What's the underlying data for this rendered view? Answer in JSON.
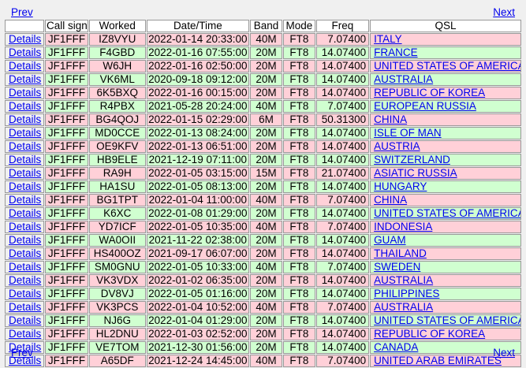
{
  "nav": {
    "prev_label": "Prev",
    "next_label": "Next"
  },
  "table": {
    "headers": [
      "",
      "Call sign",
      "Worked",
      "Date/Time",
      "Band",
      "Mode",
      "Freq",
      "QSL"
    ],
    "rows": [
      {
        "link": "Details",
        "call": "JF1FFF",
        "worked": "IZ8VYU",
        "dt": "2022-01-14 20:33:00",
        "band": "40M",
        "mode": "FT8",
        "freq": "7.07400",
        "qsl": "ITALY"
      },
      {
        "link": "Details",
        "call": "JF1FFF",
        "worked": "F4GBD",
        "dt": "2022-01-16 07:55:00",
        "band": "20M",
        "mode": "FT8",
        "freq": "14.07400",
        "qsl": "FRANCE"
      },
      {
        "link": "Details",
        "call": "JF1FFF",
        "worked": "W6JH",
        "dt": "2022-01-16 02:50:00",
        "band": "20M",
        "mode": "FT8",
        "freq": "14.07400",
        "qsl": "UNITED STATES OF AMERICA"
      },
      {
        "link": "Details",
        "call": "JF1FFF",
        "worked": "VK6ML",
        "dt": "2020-09-18 09:12:00",
        "band": "20M",
        "mode": "FT8",
        "freq": "14.07400",
        "qsl": "AUSTRALIA"
      },
      {
        "link": "Details",
        "call": "JF1FFF",
        "worked": "6K5BXQ",
        "dt": "2022-01-16 00:15:00",
        "band": "20M",
        "mode": "FT8",
        "freq": "14.07400",
        "qsl": "REPUBLIC OF KOREA"
      },
      {
        "link": "Details",
        "call": "JF1FFF",
        "worked": "R4PBX",
        "dt": "2021-05-28 20:24:00",
        "band": "40M",
        "mode": "FT8",
        "freq": "7.07400",
        "qsl": "EUROPEAN RUSSIA"
      },
      {
        "link": "Details",
        "call": "JF1FFF",
        "worked": "BG4QOJ",
        "dt": "2022-01-15 02:29:00",
        "band": "6M",
        "mode": "FT8",
        "freq": "50.31300",
        "qsl": "CHINA"
      },
      {
        "link": "Details",
        "call": "JF1FFF",
        "worked": "MD0CCE",
        "dt": "2022-01-13 08:24:00",
        "band": "20M",
        "mode": "FT8",
        "freq": "14.07400",
        "qsl": "ISLE OF MAN"
      },
      {
        "link": "Details",
        "call": "JF1FFF",
        "worked": "OE9KFV",
        "dt": "2022-01-13 06:51:00",
        "band": "20M",
        "mode": "FT8",
        "freq": "14.07400",
        "qsl": "AUSTRIA"
      },
      {
        "link": "Details",
        "call": "JF1FFF",
        "worked": "HB9ELE",
        "dt": "2021-12-19 07:11:00",
        "band": "20M",
        "mode": "FT8",
        "freq": "14.07400",
        "qsl": "SWITZERLAND"
      },
      {
        "link": "Details",
        "call": "JF1FFF",
        "worked": "RA9H",
        "dt": "2022-01-05 03:15:00",
        "band": "15M",
        "mode": "FT8",
        "freq": "21.07400",
        "qsl": "ASIATIC RUSSIA"
      },
      {
        "link": "Details",
        "call": "JF1FFF",
        "worked": "HA1SU",
        "dt": "2022-01-05 08:13:00",
        "band": "20M",
        "mode": "FT8",
        "freq": "14.07400",
        "qsl": "HUNGARY"
      },
      {
        "link": "Details",
        "call": "JF1FFF",
        "worked": "BG1TPT",
        "dt": "2022-01-04 11:00:00",
        "band": "40M",
        "mode": "FT8",
        "freq": "7.07400",
        "qsl": "CHINA"
      },
      {
        "link": "Details",
        "call": "JF1FFF",
        "worked": "K6XC",
        "dt": "2022-01-08 01:29:00",
        "band": "20M",
        "mode": "FT8",
        "freq": "14.07400",
        "qsl": "UNITED STATES OF AMERICA"
      },
      {
        "link": "Details",
        "call": "JF1FFF",
        "worked": "YD7ICF",
        "dt": "2022-01-05 10:35:00",
        "band": "40M",
        "mode": "FT8",
        "freq": "7.07400",
        "qsl": "INDONESIA"
      },
      {
        "link": "Details",
        "call": "JF1FFF",
        "worked": "WA0OII",
        "dt": "2021-11-22 02:38:00",
        "band": "20M",
        "mode": "FT8",
        "freq": "14.07400",
        "qsl": "GUAM"
      },
      {
        "link": "Details",
        "call": "JF1FFF",
        "worked": "HS400OZ",
        "dt": "2021-09-17 06:07:00",
        "band": "20M",
        "mode": "FT8",
        "freq": "14.07400",
        "qsl": "THAILAND"
      },
      {
        "link": "Details",
        "call": "JF1FFF",
        "worked": "SM0GNU",
        "dt": "2022-01-05 10:33:00",
        "band": "40M",
        "mode": "FT8",
        "freq": "7.07400",
        "qsl": "SWEDEN"
      },
      {
        "link": "Details",
        "call": "JF1FFF",
        "worked": "VK3VDX",
        "dt": "2022-01-02 06:35:00",
        "band": "20M",
        "mode": "FT8",
        "freq": "14.07400",
        "qsl": "AUSTRALIA"
      },
      {
        "link": "Details",
        "call": "JF1FFF",
        "worked": "DV8VJ",
        "dt": "2022-01-05 01:16:00",
        "band": "20M",
        "mode": "FT8",
        "freq": "14.07400",
        "qsl": "PHILIPPINES"
      },
      {
        "link": "Details",
        "call": "JF1FFF",
        "worked": "VK3PCS",
        "dt": "2022-01-04 10:52:00",
        "band": "40M",
        "mode": "FT8",
        "freq": "7.07400",
        "qsl": "AUSTRALIA"
      },
      {
        "link": "Details",
        "call": "JF1FFF",
        "worked": "NJ6G",
        "dt": "2022-01-04 01:29:00",
        "band": "20M",
        "mode": "FT8",
        "freq": "14.07400",
        "qsl": "UNITED STATES OF AMERICA"
      },
      {
        "link": "Details",
        "call": "JF1FFF",
        "worked": "HL2DNU",
        "dt": "2022-01-03 02:52:00",
        "band": "20M",
        "mode": "FT8",
        "freq": "14.07400",
        "qsl": "REPUBLIC OF KOREA"
      },
      {
        "link": "Details",
        "call": "JF1FFF",
        "worked": "VE7TOM",
        "dt": "2021-12-30 01:56:00",
        "band": "20M",
        "mode": "FT8",
        "freq": "14.07400",
        "qsl": "CANADA"
      },
      {
        "link": "Details",
        "call": "JF1FFF",
        "worked": "A65DF",
        "dt": "2021-12-24 14:45:00",
        "band": "40M",
        "mode": "FT8",
        "freq": "7.07400",
        "qsl": "UNITED ARAB EMIRATES"
      }
    ]
  },
  "colors": {
    "row_odd": "#ffd0d8",
    "row_even": "#d0ffd0",
    "link": "#0000ee",
    "background": "#f0f0f0"
  }
}
